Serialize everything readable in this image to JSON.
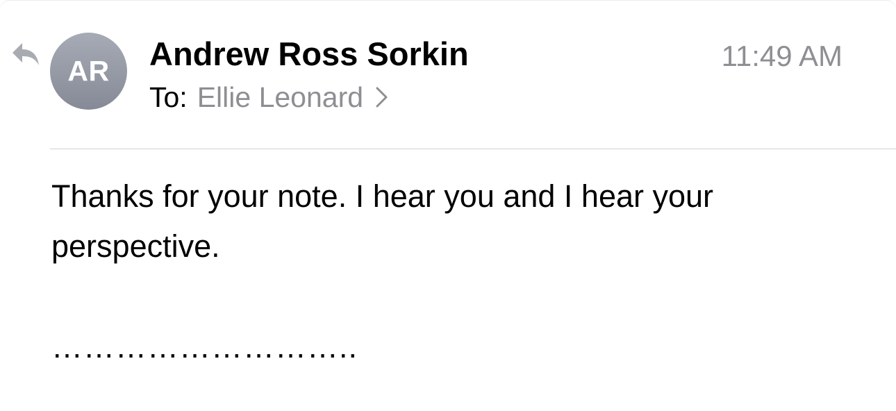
{
  "message": {
    "sender_name": "Andrew Ross Sorkin",
    "sender_initials": "AR",
    "time": "11:49 AM",
    "to_label": "To:",
    "recipient": "Ellie Leonard",
    "body_text": "Thanks for your note. I hear you and I hear your perspective.",
    "signature": "……………………….."
  },
  "icons": {
    "replied": "reply-arrow-icon",
    "recipient_disclosure": "chevron-right-icon"
  },
  "colors": {
    "avatar_top": "#a7abb6",
    "avatar_bottom": "#868a96",
    "secondary_text": "#8e8e93",
    "reply_icon": "#a9abb3",
    "divider": "#d2d2d6"
  }
}
